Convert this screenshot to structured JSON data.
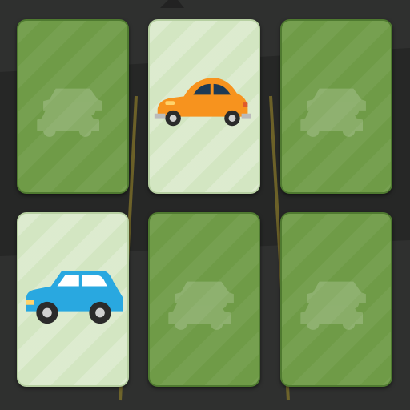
{
  "game": {
    "board": {
      "rows": 2,
      "columns": 3,
      "card_back_icon": "cars-icon"
    },
    "cards": [
      {
        "state": "face-down",
        "icon": "cars-icon"
      },
      {
        "state": "face-up",
        "icon": "orange-beetle-car-icon"
      },
      {
        "state": "face-down",
        "icon": "cars-icon"
      },
      {
        "state": "face-up",
        "icon": "blue-hatchback-car-icon"
      },
      {
        "state": "face-down",
        "icon": "cars-icon"
      },
      {
        "state": "face-down",
        "icon": "cars-icon"
      }
    ],
    "colors": {
      "card_back": "#6f9b47",
      "card_front": "#d3e6c2",
      "background": "#2f302f",
      "orange_car": "#f7931e",
      "blue_car": "#29a8e0"
    }
  }
}
